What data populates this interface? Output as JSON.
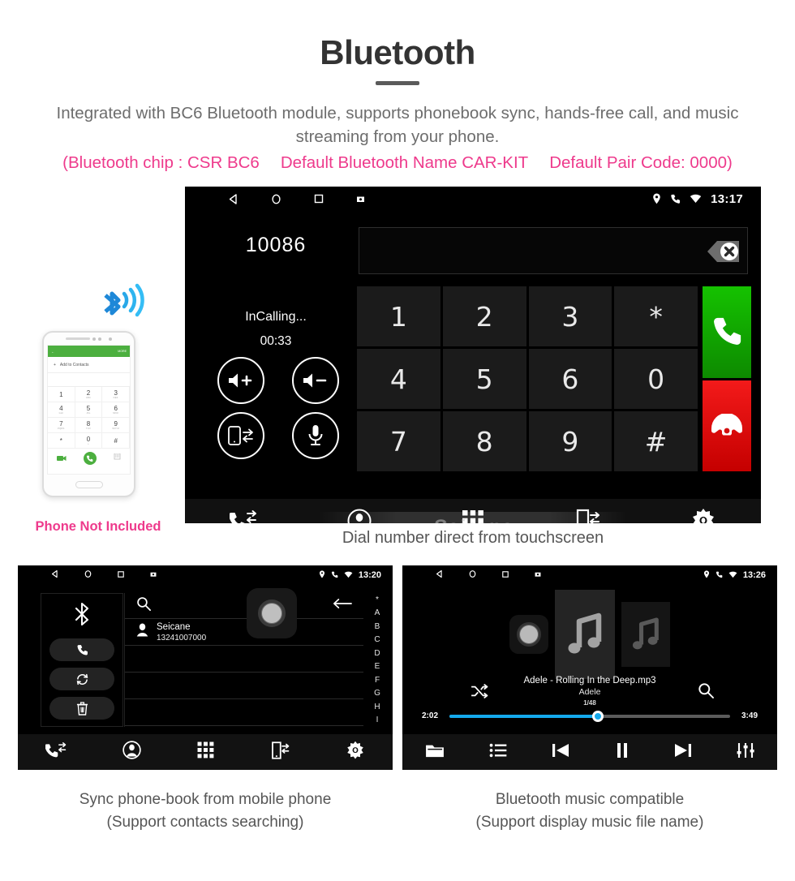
{
  "header": {
    "title": "Bluetooth",
    "subtitle": "Integrated with BC6 Bluetooth module, supports phonebook sync, hands-free call, and music streaming from your phone.",
    "spec_chip": "(Bluetooth chip : CSR BC6",
    "spec_name": "Default Bluetooth Name CAR-KIT",
    "spec_pair": "Default Pair Code: 0000)",
    "accent_pink": "#ee3a8c",
    "subtitle_color": "#6d6d6d"
  },
  "dialer": {
    "statusbar": {
      "time": "13:17",
      "nav_icons": [
        "back-icon",
        "home-icon",
        "recents-icon",
        "screenshot-icon"
      ],
      "status_icons": [
        "location-icon",
        "phone-icon",
        "wifi-icon"
      ]
    },
    "number": "10086",
    "call_state": "InCalling...",
    "call_timer": "00:33",
    "controls": [
      {
        "name": "volume-up-icon",
        "label": "Volume Up"
      },
      {
        "name": "volume-down-icon",
        "label": "Volume Down"
      },
      {
        "name": "transfer-to-phone-icon",
        "label": "Transfer To Phone"
      },
      {
        "name": "microphone-mute-icon",
        "label": "Mute"
      }
    ],
    "input_value": "",
    "input_placeholder": "",
    "delete_icon": "backspace-delete-icon",
    "keys": [
      "1",
      "2",
      "3",
      "*",
      "4",
      "5",
      "6",
      "0",
      "7",
      "8",
      "9",
      "#"
    ],
    "call_button": "call-icon",
    "hangup_button": "hangup-icon",
    "tabs": [
      {
        "name": "tab-call-history",
        "icon": "call-history-icon"
      },
      {
        "name": "tab-contacts",
        "icon": "contacts-icon"
      },
      {
        "name": "tab-keypad",
        "icon": "keypad-grid-icon"
      },
      {
        "name": "tab-phone-link",
        "icon": "phone-link-icon"
      },
      {
        "name": "tab-settings",
        "icon": "gear-icon"
      }
    ],
    "watermark": "Seicane",
    "caption": "Dial number direct from touchscreen"
  },
  "phone_mock": {
    "header_back": "←",
    "header_more": "MORE",
    "add_contacts": "Add to Contacts",
    "keys": [
      {
        "d": "1",
        "s": ""
      },
      {
        "d": "2",
        "s": "ABC"
      },
      {
        "d": "3",
        "s": "DEF"
      },
      {
        "d": "4",
        "s": "GHI"
      },
      {
        "d": "5",
        "s": "JKL"
      },
      {
        "d": "6",
        "s": "MNO"
      },
      {
        "d": "7",
        "s": "PQRS"
      },
      {
        "d": "8",
        "s": "TUV"
      },
      {
        "d": "9",
        "s": "WXYZ"
      },
      {
        "d": "*",
        "s": ""
      },
      {
        "d": "0",
        "s": "+"
      },
      {
        "d": "#",
        "s": ""
      }
    ],
    "note": "Phone Not Included",
    "bluetooth_icon": "bluetooth-signal-icon"
  },
  "contacts_panel": {
    "statusbar": {
      "time": "13:20"
    },
    "side_buttons": [
      {
        "name": "bluetooth-icon"
      },
      {
        "name": "call-icon"
      },
      {
        "name": "sync-icon"
      },
      {
        "name": "delete-icon"
      }
    ],
    "search_icon": "search-icon",
    "back_icon": "back-arrow-icon",
    "contact_name": "Seicane",
    "contact_number": "13241007000",
    "alpha_index": [
      "*",
      "A",
      "B",
      "C",
      "D",
      "E",
      "F",
      "G",
      "H",
      "I"
    ],
    "tabs": [
      {
        "name": "tab-call-history",
        "icon": "call-history-icon"
      },
      {
        "name": "tab-contacts",
        "icon": "contacts-icon"
      },
      {
        "name": "tab-keypad",
        "icon": "keypad-grid-icon"
      },
      {
        "name": "tab-phone-link",
        "icon": "phone-link-icon"
      },
      {
        "name": "tab-settings",
        "icon": "gear-icon"
      }
    ],
    "caption_line1": "Sync phone-book from mobile phone",
    "caption_line2": "(Support contacts searching)"
  },
  "music_panel": {
    "statusbar": {
      "time": "13:26"
    },
    "track_title": "Adele - Rolling In the Deep.mp3",
    "artist": "Adele",
    "track_index": "1/48",
    "elapsed": "2:02",
    "duration": "3:49",
    "progress_percent": 53,
    "progress_color": "#14a9ec",
    "shuffle_icon": "shuffle-icon",
    "search_icon": "search-icon",
    "controls": [
      {
        "name": "folder-icon"
      },
      {
        "name": "playlist-icon"
      },
      {
        "name": "previous-icon"
      },
      {
        "name": "pause-icon"
      },
      {
        "name": "next-icon"
      },
      {
        "name": "equalizer-icon"
      }
    ],
    "caption_line1": "Bluetooth music compatible",
    "caption_line2": "(Support display music file name)"
  }
}
